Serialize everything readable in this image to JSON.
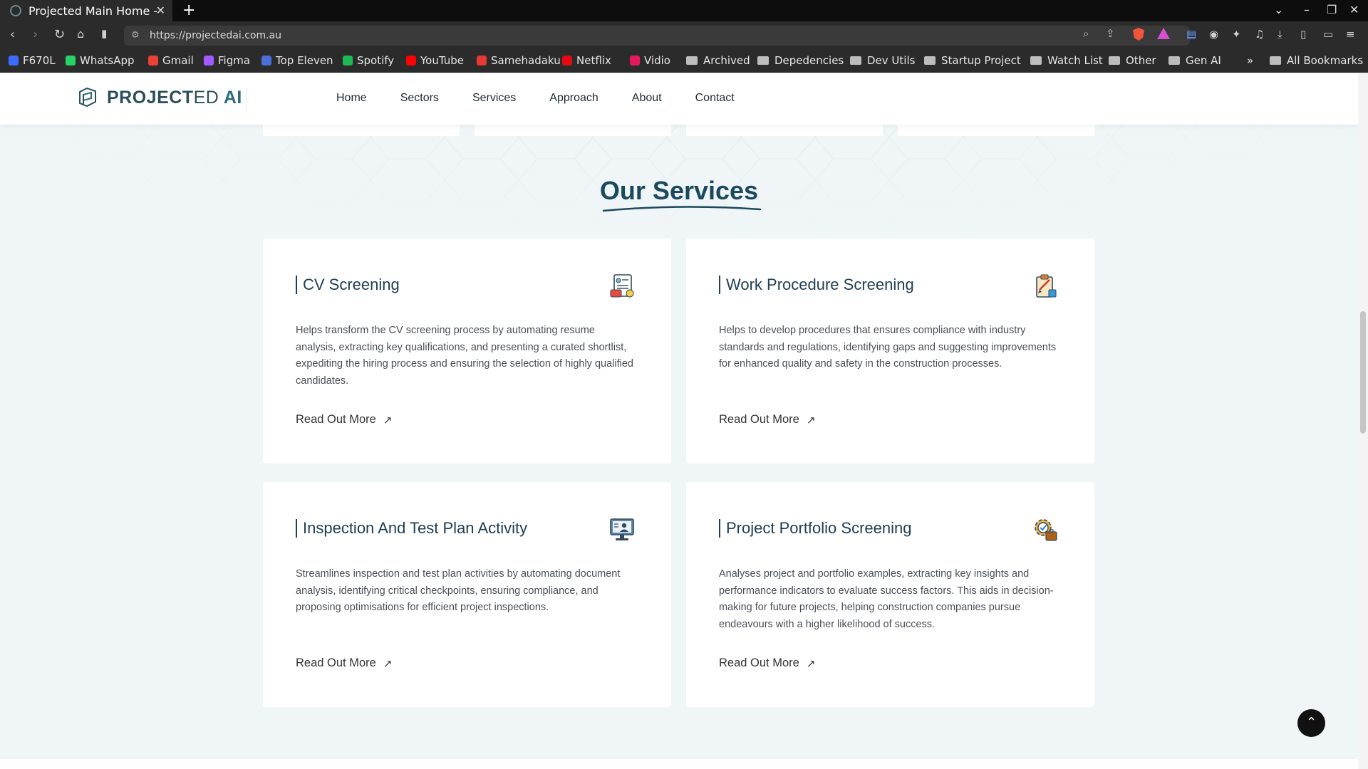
{
  "browser": {
    "tab_title": "Projected Main Home - De",
    "url": "https://projectedai.com.au",
    "bookmarks": [
      {
        "label": "F670L",
        "icon": "zte-icon",
        "color": "#3b6cff"
      },
      {
        "label": "WhatsApp",
        "icon": "whatsapp-icon",
        "color": "#25d366"
      },
      {
        "label": "Gmail",
        "icon": "gmail-icon",
        "color": "#ea4335"
      },
      {
        "label": "Figma",
        "icon": "figma-icon",
        "color": "#a259ff"
      },
      {
        "label": "Top Eleven",
        "icon": "top-eleven-icon",
        "color": "#4a6fd6"
      },
      {
        "label": "Spotify",
        "icon": "spotify-icon",
        "color": "#1db954"
      },
      {
        "label": "YouTube",
        "icon": "youtube-icon",
        "color": "#ff0000"
      },
      {
        "label": "Samehadaku",
        "icon": "samehadaku-icon",
        "color": "#e53935"
      },
      {
        "label": "Netflix",
        "icon": "netflix-icon",
        "color": "#e50914"
      },
      {
        "label": "Vidio",
        "icon": "vidio-icon",
        "color": "#e5195c"
      }
    ],
    "bookmark_folders": [
      "Archived",
      "Depedencies",
      "Dev Utils",
      "Startup Project",
      "Watch List",
      "Other",
      "Gen AI"
    ],
    "all_bookmarks": "All Bookmarks",
    "overflow": "»"
  },
  "site": {
    "brand_bold": "PROJECT",
    "brand_thin": "ED",
    "brand_ai": "AI",
    "nav": [
      "Home",
      "Sectors",
      "Services",
      "Approach",
      "About",
      "Contact"
    ]
  },
  "services": {
    "title": "Our Services",
    "read_more": "Read Out More",
    "cards": [
      {
        "title": "CV Screening",
        "icon": "cv-document-icon",
        "description": "Helps transform the CV screening process by automating resume analysis, extracting key qualifications, and presenting a curated shortlist, expediting the hiring process and ensuring the selection of highly qualified candidates."
      },
      {
        "title": "Work Procedure Screening",
        "icon": "clipboard-pen-icon",
        "description": "Helps to develop procedures that ensures compliance with industry standards and regulations, identifying gaps and suggesting improvements for enhanced quality and safety in the construction processes."
      },
      {
        "title": "Inspection And Test Plan Activity",
        "icon": "monitor-inspection-icon",
        "description": "Streamlines inspection and test plan activities by automating document analysis, identifying critical checkpoints, ensuring compliance, and proposing optimisations for efficient project inspections."
      },
      {
        "title": "Project Portfolio Screening",
        "icon": "gear-portfolio-icon",
        "description": "Analyses project and portfolio examples, extracting key insights and performance indicators to evaluate success factors. This aids in decision-making for future projects, helping construction companies pursue endeavours with a higher likelihood of success."
      }
    ]
  },
  "colors": {
    "brand": "#2a4f5c",
    "heading": "#1b4a5c",
    "page_bg": "#f0f6f7"
  }
}
